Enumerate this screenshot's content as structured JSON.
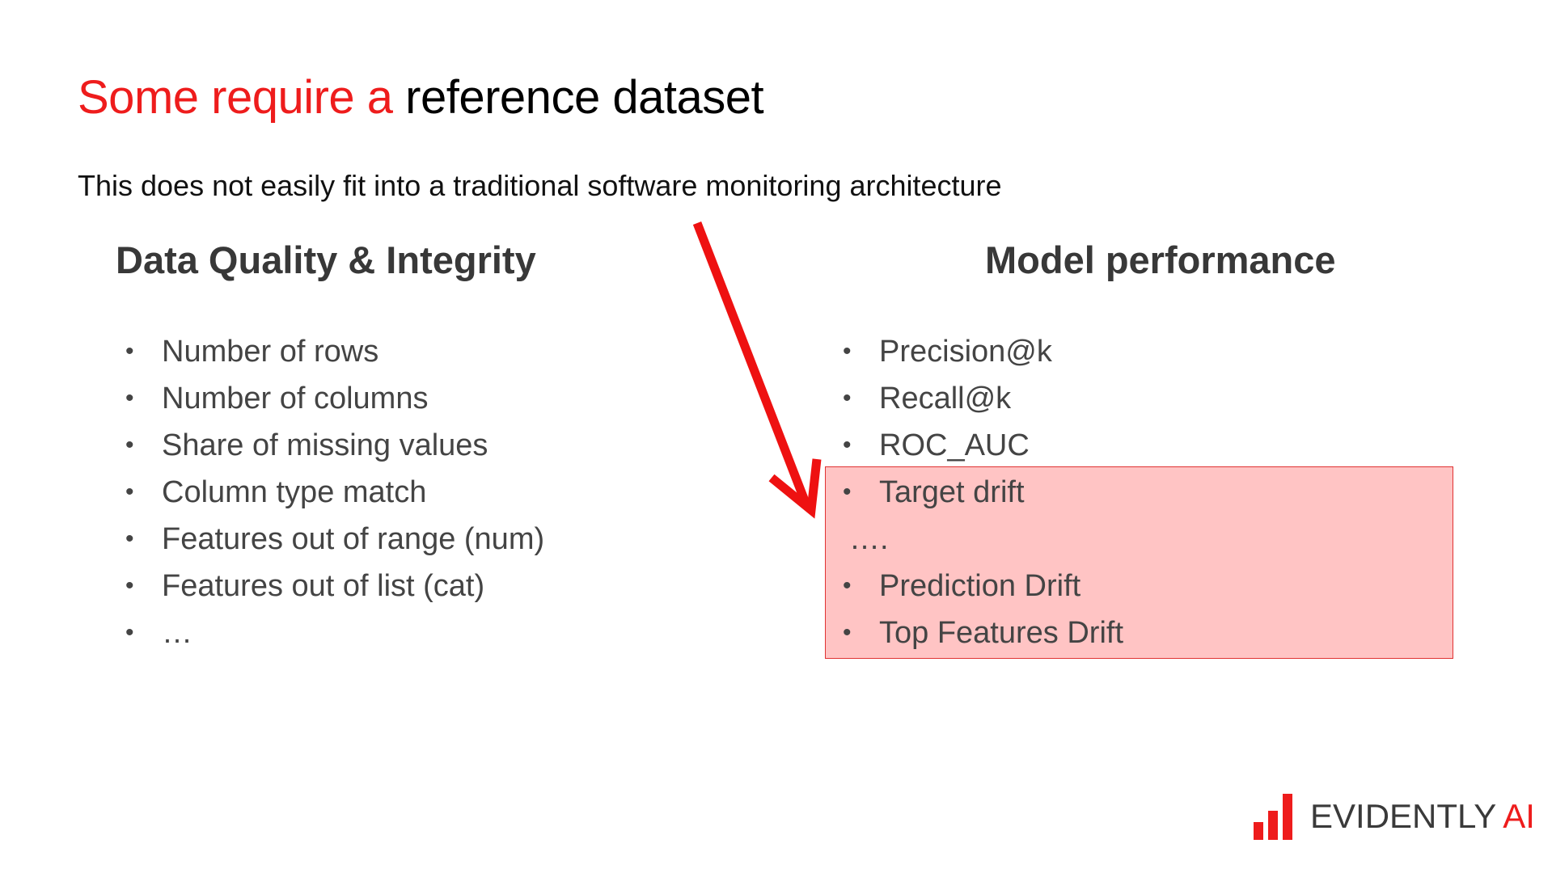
{
  "title": {
    "red_part": "Some require a",
    "black_part": "reference dataset"
  },
  "subtitle": "This does not easily fit into a traditional software monitoring architecture",
  "columns": {
    "left": {
      "heading": "Data Quality & Integrity",
      "items": [
        "Number of rows",
        "Number of columns",
        "Share of missing values",
        "Column type match",
        "Features out of range (num)",
        "Features out of list (cat)",
        "…"
      ]
    },
    "right": {
      "heading": "Model performance",
      "items": [
        "Precision@k",
        "Recall@k",
        "ROC_AUC",
        "Target drift",
        "….",
        "Prediction Drift",
        "Top Features Drift"
      ]
    }
  },
  "bullet_char": "•",
  "logo": {
    "name": "EVIDENTLY",
    "suffix": "AI"
  },
  "colors": {
    "accent": "#ee1c1c",
    "highlight_fill": "#ffc2c2",
    "text": "#444444"
  },
  "icons": {
    "arrow": "arrow-down-right-icon",
    "logo_bars": "bar-chart-logo-icon"
  }
}
